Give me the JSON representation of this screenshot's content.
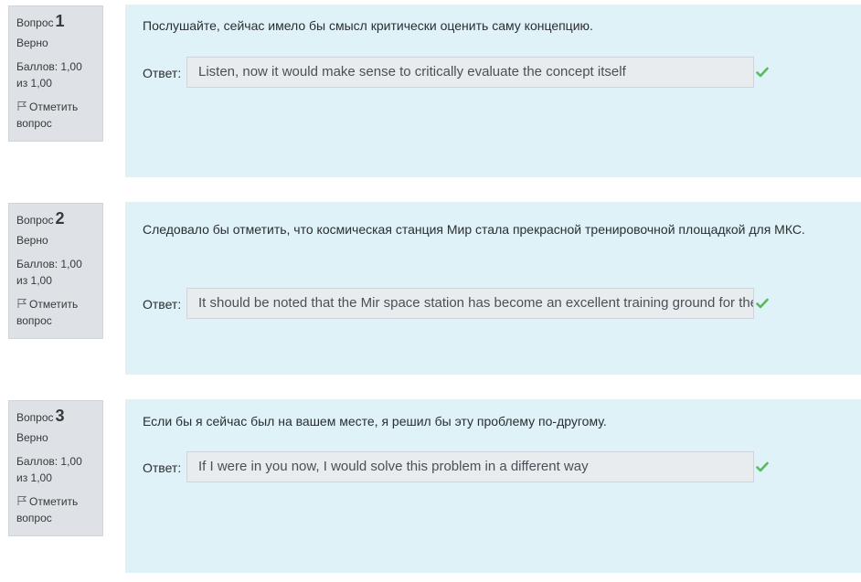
{
  "questions": [
    {
      "label": "Вопрос",
      "number": "1",
      "state": "Верно",
      "grade": "Баллов: 1,00 из 1,00",
      "flag_label": "Отметить вопрос",
      "text": "Послушайте, сейчас имело бы смысл критически оценить саму концепцию.",
      "answer_label": "Ответ:",
      "answer": "Listen, now it would make sense to critically evaluate the concept itself"
    },
    {
      "label": "Вопрос",
      "number": "2",
      "state": "Верно",
      "grade": "Баллов: 1,00 из 1,00",
      "flag_label": "Отметить вопрос",
      "text": "Следовало бы отметить, что космическая станция Мир стала прекрасной тренировочной площадкой для МКС.",
      "answer_label": "Ответ:",
      "answer": "It should be noted that the Mir space station has become an excellent training ground for the ISS"
    },
    {
      "label": "Вопрос",
      "number": "3",
      "state": "Верно",
      "grade": "Баллов: 1,00 из 1,00",
      "flag_label": "Отметить вопрос",
      "text": "Если бы я сейчас был на вашем месте, я решил бы эту проблему по-другому.",
      "answer_label": "Ответ:",
      "answer": "If I were in you now, I would solve this problem in a different way"
    }
  ],
  "colors": {
    "info_bg": "#dee2e6",
    "content_bg": "#def2f8",
    "correct": "#5cb85c"
  },
  "icons": {
    "flag": "flag-icon",
    "correct": "check-icon"
  }
}
